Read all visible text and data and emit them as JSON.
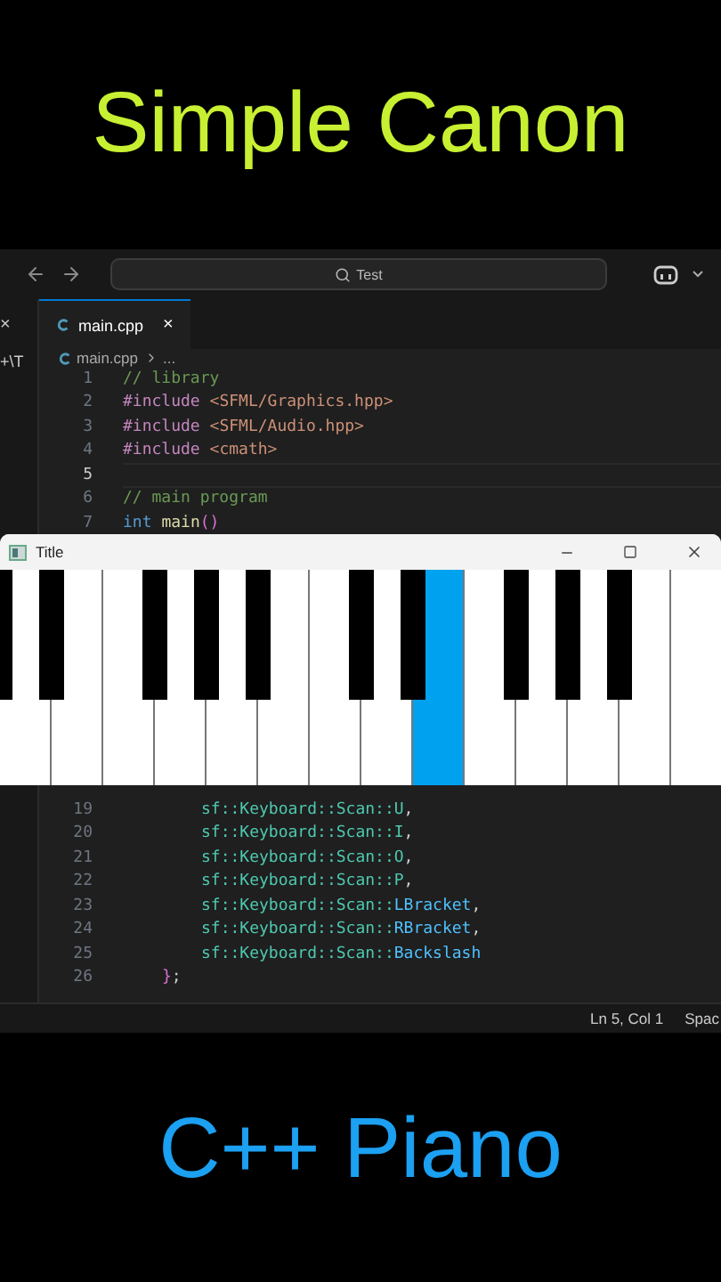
{
  "headline": "Simple Canon",
  "ide": {
    "search": {
      "value": "Test"
    },
    "side_tab": {
      "close": "×"
    },
    "side_path": "+\\T",
    "tabs": [
      {
        "label": "main.cpp",
        "close": "×",
        "selected": true
      }
    ],
    "breadcrumb": {
      "file": "main.cpp",
      "more": "..."
    },
    "code_top": [
      {
        "number": "1",
        "kind": "top",
        "current": false,
        "tokens": [
          {
            "kind": "comment",
            "text": "// library"
          }
        ]
      },
      {
        "number": "2",
        "kind": "top",
        "current": false,
        "tokens": [
          {
            "kind": "directive",
            "text": "#include "
          },
          {
            "kind": "string",
            "text": "<SFML/Graphics.hpp>"
          }
        ]
      },
      {
        "number": "3",
        "kind": "top",
        "current": false,
        "tokens": [
          {
            "kind": "directive",
            "text": "#include "
          },
          {
            "kind": "string",
            "text": "<SFML/Audio.hpp>"
          }
        ]
      },
      {
        "number": "4",
        "kind": "top",
        "current": false,
        "tokens": [
          {
            "kind": "directive",
            "text": "#include "
          },
          {
            "kind": "string",
            "text": "<cmath>"
          }
        ]
      },
      {
        "number": "5",
        "kind": "top",
        "current": true
      },
      {
        "number": "6",
        "kind": "top",
        "current": false,
        "tokens": [
          {
            "kind": "comment",
            "text": "// main program"
          }
        ]
      },
      {
        "number": "7",
        "kind": "top",
        "current": false,
        "tokens": [
          {
            "kind": "keyword",
            "text": "int "
          },
          {
            "kind": "function",
            "text": "main"
          },
          {
            "kind": "paren",
            "text": "()"
          }
        ]
      }
    ],
    "code_bottom": [
      {
        "number": "19",
        "kind": "inner",
        "current": false,
        "tokens": [
          {
            "kind": "type",
            "text": "sf::Keyboard::Scan::U"
          },
          {
            "kind": "plain",
            "text": ","
          }
        ]
      },
      {
        "number": "20",
        "kind": "inner",
        "current": false,
        "tokens": [
          {
            "kind": "type",
            "text": "sf::Keyboard::Scan::I"
          },
          {
            "kind": "plain",
            "text": ","
          }
        ]
      },
      {
        "number": "21",
        "kind": "inner",
        "current": false,
        "tokens": [
          {
            "kind": "type",
            "text": "sf::Keyboard::Scan::O"
          },
          {
            "kind": "plain",
            "text": ","
          }
        ]
      },
      {
        "number": "22",
        "kind": "inner",
        "current": false,
        "tokens": [
          {
            "kind": "type",
            "text": "sf::Keyboard::Scan::P"
          },
          {
            "kind": "plain",
            "text": ","
          }
        ]
      },
      {
        "number": "23",
        "kind": "inner",
        "current": false,
        "tokens": [
          {
            "kind": "type",
            "text": "sf::Keyboard::Scan::"
          },
          {
            "kind": "enum",
            "text": "LBracket"
          },
          {
            "kind": "plain",
            "text": ","
          }
        ]
      },
      {
        "number": "24",
        "kind": "inner",
        "current": false,
        "tokens": [
          {
            "kind": "type",
            "text": "sf::Keyboard::Scan::"
          },
          {
            "kind": "enum",
            "text": "RBracket"
          },
          {
            "kind": "plain",
            "text": ","
          }
        ]
      },
      {
        "number": "25",
        "kind": "inner",
        "current": false,
        "tokens": [
          {
            "kind": "type",
            "text": "sf::Keyboard::Scan::"
          },
          {
            "kind": "enum",
            "text": "Backslash"
          }
        ]
      },
      {
        "number": "26",
        "kind": "block",
        "current": false,
        "tokens": [
          {
            "kind": "paren",
            "text": "}"
          },
          {
            "kind": "plain",
            "text": ";"
          }
        ]
      }
    ],
    "status_bar": {
      "position": "Ln 5, Col 1",
      "indent": "Spac"
    }
  },
  "piano_window": {
    "title": "Title",
    "keys": [
      {
        "black_left": true,
        "pressed": false
      },
      {
        "black_left": true,
        "pressed": false
      },
      {
        "black_left": false,
        "pressed": false
      },
      {
        "black_left": true,
        "pressed": false
      },
      {
        "black_left": true,
        "pressed": false
      },
      {
        "black_left": true,
        "pressed": false
      },
      {
        "black_left": false,
        "pressed": false
      },
      {
        "black_left": true,
        "pressed": false
      },
      {
        "black_left": true,
        "pressed": true
      },
      {
        "black_left": false,
        "pressed": false
      },
      {
        "black_left": true,
        "pressed": false
      },
      {
        "black_left": true,
        "pressed": false
      },
      {
        "black_left": true,
        "pressed": false
      },
      {
        "black_left": false,
        "pressed": false
      }
    ]
  },
  "footline": "C++ Piano"
}
